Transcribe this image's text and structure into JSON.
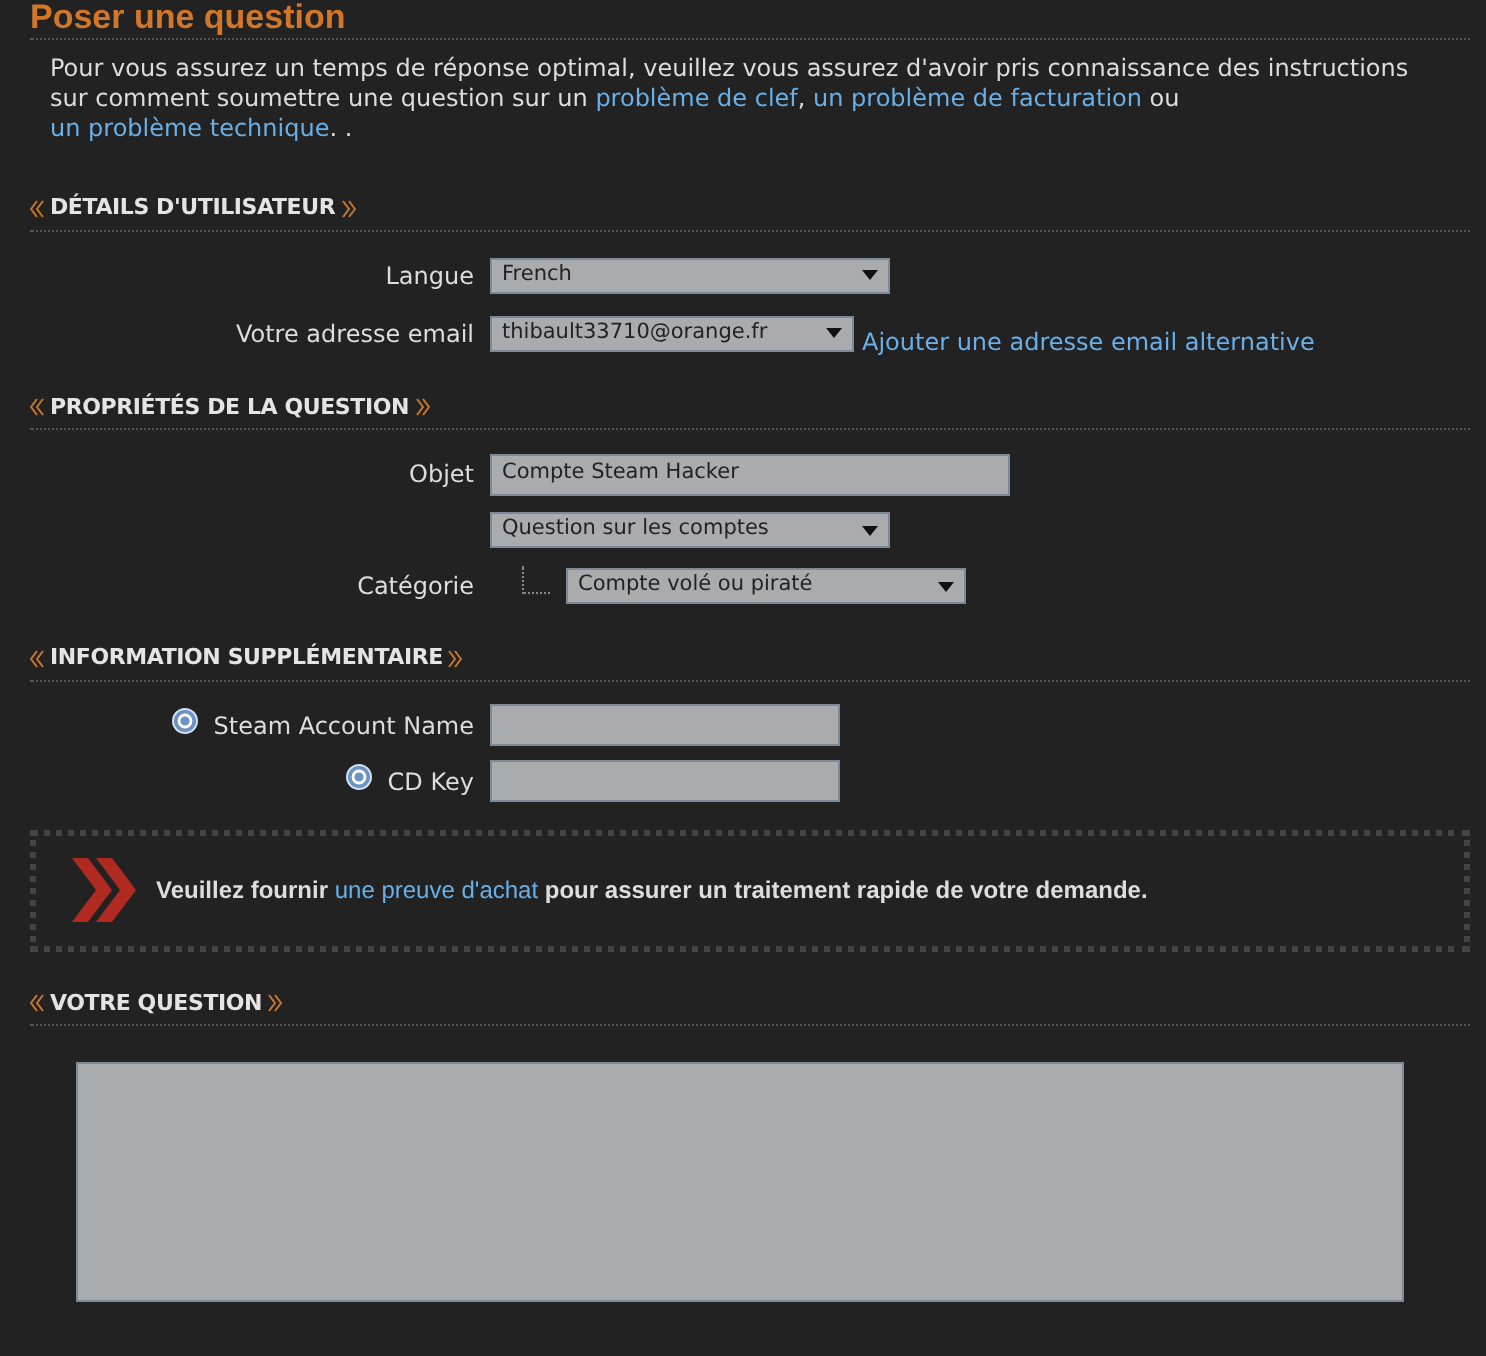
{
  "title": "Poser une question",
  "intro": [
    {
      "kind": "text",
      "text": "Pour vous assurez un temps de réponse optimal, veuillez vous assurez d'avoir pris connaissance des instructions sur comment soumettre une question sur un "
    },
    {
      "kind": "link",
      "text": "problème de clef"
    },
    {
      "kind": "text",
      "text": ", "
    },
    {
      "kind": "link",
      "text": "un problème de facturation"
    },
    {
      "kind": "text",
      "text": " ou "
    },
    {
      "kind": "link",
      "text": "un problème technique"
    },
    {
      "kind": "text",
      "text": ". ."
    }
  ],
  "sections": [
    {
      "heading": "DÉTAILS D'UTILISATEUR",
      "fields": [
        {
          "kind": "select",
          "label": "Langue",
          "value": "French"
        },
        {
          "kind": "select",
          "label": "Votre adresse email",
          "value": "thibault33710@orange.fr",
          "link": "Ajouter une adresse email alternative"
        }
      ]
    },
    {
      "heading": "PROPRIÉTÉS DE LA QUESTION",
      "fields": [
        {
          "kind": "text",
          "label": "Objet",
          "value": "Compte Steam Hacker"
        },
        {
          "kind": "select",
          "value": "Question sur les comptes"
        },
        {
          "kind": "subselect",
          "label": "Catégorie",
          "value": "Compte volé ou piraté"
        }
      ]
    },
    {
      "heading": "INFORMATION SUPPLÉMENTAIRE",
      "fields": [
        {
          "kind": "text",
          "label": "Steam Account Name",
          "help": true
        },
        {
          "kind": "text",
          "label": "CD Key",
          "help": true
        }
      ]
    }
  ],
  "notice": [
    {
      "kind": "text",
      "text": "Veuillez fournir "
    },
    {
      "kind": "link",
      "text": "une preuve d'achat"
    },
    {
      "kind": "text",
      "text": " pour assurer un traitement rapide de votre demande."
    }
  ],
  "question": {
    "heading": "VOTRE QUESTION"
  }
}
